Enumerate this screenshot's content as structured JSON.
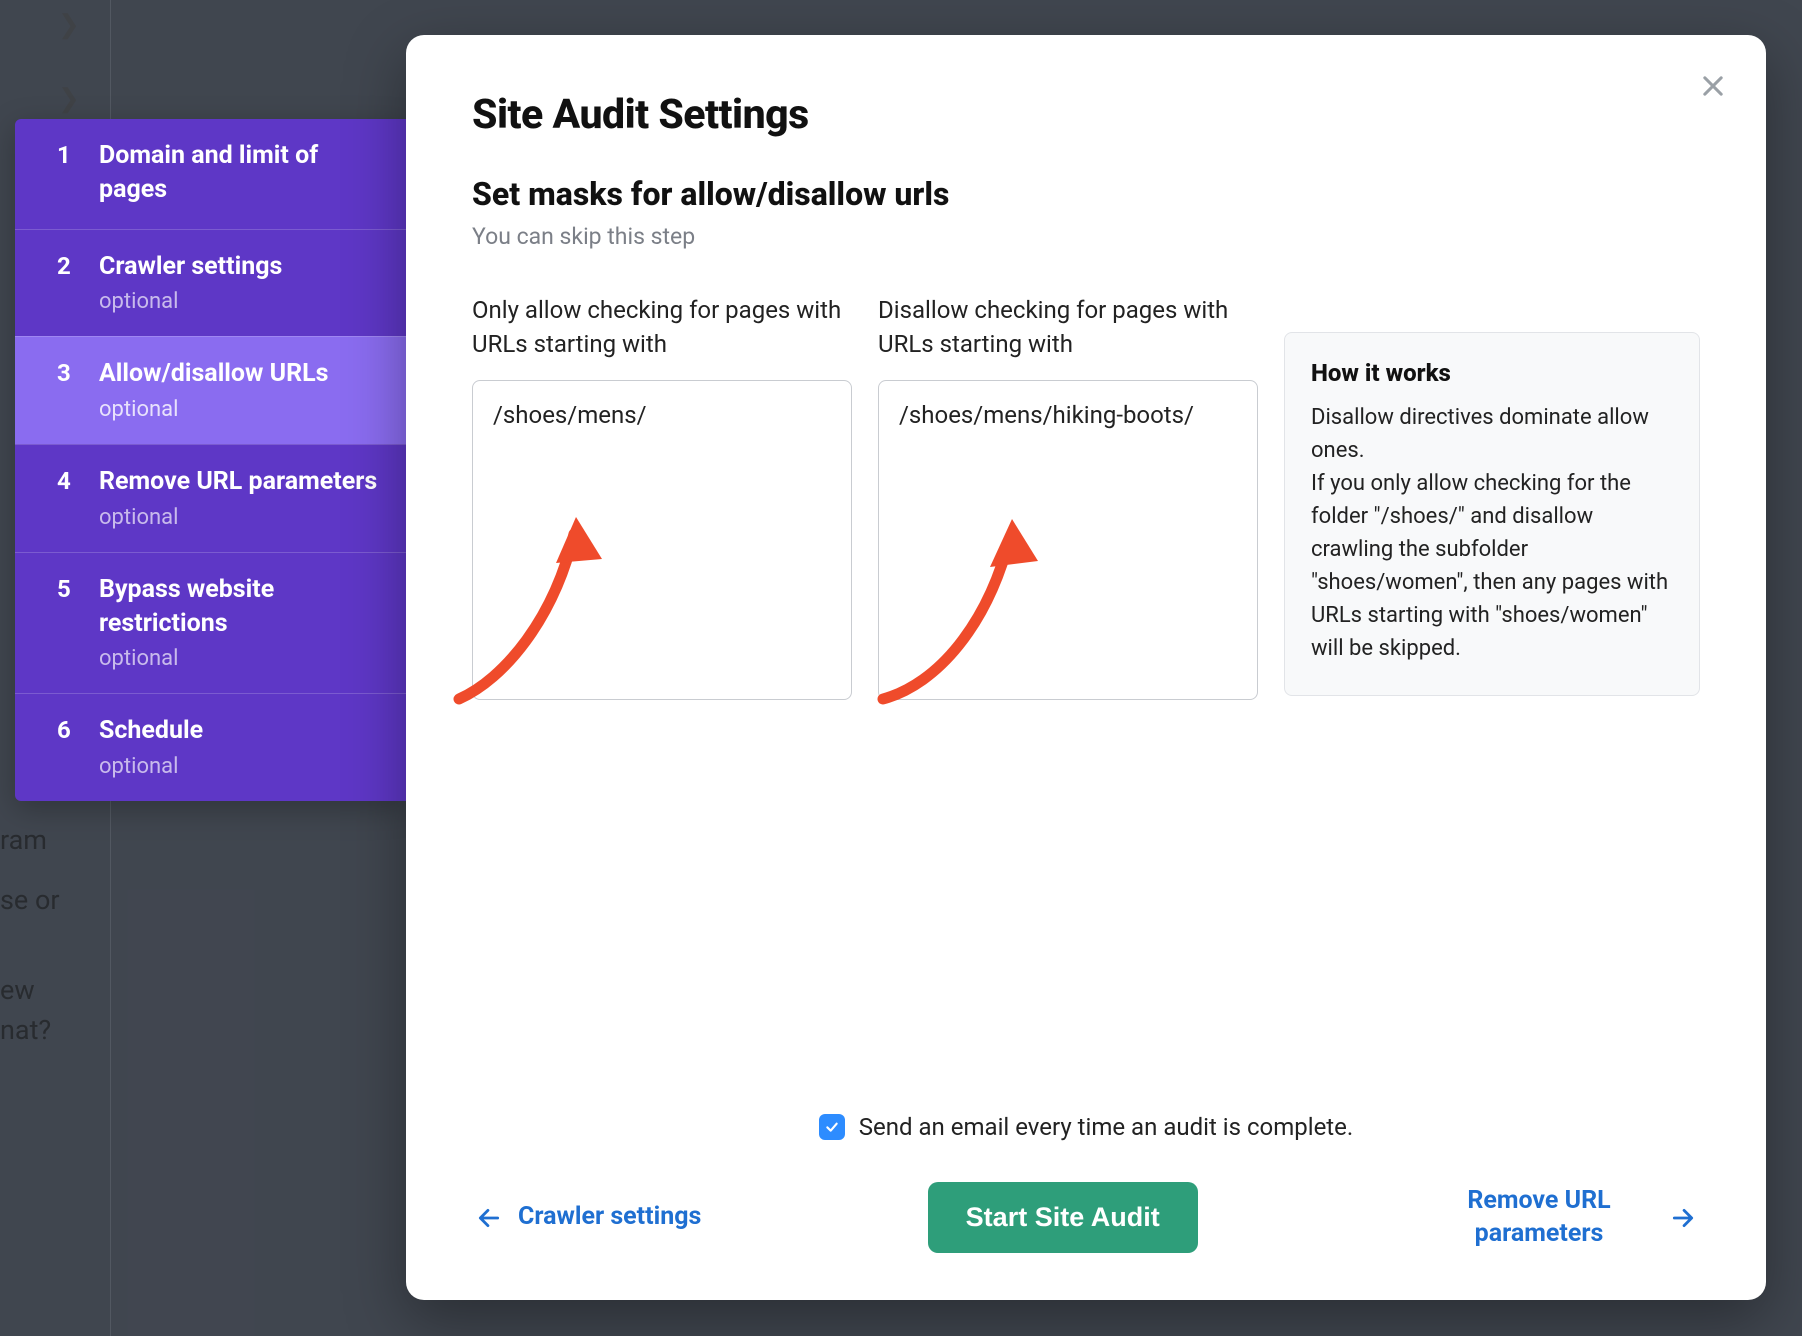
{
  "bg": {
    "line1": "ram",
    "line2": "se or",
    "line3": "ew",
    "line4": "nat?"
  },
  "wizard": {
    "steps": [
      {
        "num": "1",
        "label": "Domain and limit of pages",
        "optional": ""
      },
      {
        "num": "2",
        "label": "Crawler settings",
        "optional": "optional"
      },
      {
        "num": "3",
        "label": "Allow/disallow URLs",
        "optional": "optional"
      },
      {
        "num": "4",
        "label": "Remove URL parameters",
        "optional": "optional"
      },
      {
        "num": "5",
        "label": "Bypass website restrictions",
        "optional": "optional"
      },
      {
        "num": "6",
        "label": "Schedule",
        "optional": "optional"
      }
    ],
    "active_index": 2
  },
  "modal": {
    "title": "Site Audit Settings",
    "subtitle": "Set masks for allow/disallow urls",
    "skip": "You can skip this step",
    "allow_label": "Only allow checking for pages with URLs starting with",
    "allow_value": "/shoes/mens/",
    "disallow_label": "Disallow checking for pages with URLs starting with",
    "disallow_value": "/shoes/mens/hiking-boots/",
    "info_title": "How it works",
    "info_body1": "Disallow directives dominate allow ones.",
    "info_body2": "If you only allow checking for the folder \"/shoes/\" and disallow crawling the subfolder \"shoes/women\", then any pages with URLs starting with \"shoes/women\" will be skipped.",
    "email_label": "Send an email every time an audit is complete.",
    "email_checked": true,
    "back_label": "Crawler settings",
    "primary_label": "Start Site Audit",
    "next_label": "Remove URL parameters"
  }
}
